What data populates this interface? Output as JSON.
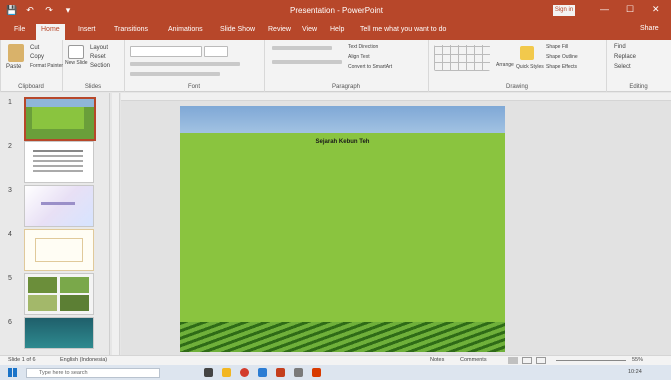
{
  "window": {
    "title": "Presentation - PowerPoint",
    "sign_in": "Sign in",
    "minimize": "—",
    "maximize": "☐",
    "close": "✕"
  },
  "qat": {
    "save": "💾",
    "undo": "↶",
    "redo": "↷",
    "more": "▾"
  },
  "tabs": [
    "File",
    "Home",
    "Insert",
    "Transitions",
    "Animations",
    "Slide Show",
    "Review",
    "View",
    "Help",
    "Tell me what you want to do"
  ],
  "share_label": "Share",
  "ribbon": {
    "clipboard": {
      "paste": "Paste",
      "cut": "Cut",
      "copy": "Copy",
      "format_painter": "Format Painter",
      "label": "Clipboard"
    },
    "slides": {
      "new_slide": "New Slide",
      "layout": "Layout",
      "reset": "Reset",
      "section": "Section",
      "label": "Slides"
    },
    "font": {
      "label": "Font"
    },
    "paragraph": {
      "text_direction": "Text Direction",
      "align_text": "Align Text",
      "convert_smartart": "Convert to SmartArt",
      "label": "Paragraph"
    },
    "drawing": {
      "arrange": "Arrange",
      "quick_styles": "Quick Styles",
      "shape_fill": "Shape Fill",
      "shape_outline": "Shape Outline",
      "shape_effects": "Shape Effects",
      "label": "Drawing"
    },
    "editing": {
      "find": "Find",
      "replace": "Replace",
      "select": "Select",
      "label": "Editing"
    }
  },
  "slide_numbers": [
    "1",
    "2",
    "3",
    "4",
    "5",
    "6"
  ],
  "slide": {
    "title": "Sejarah Kebun Teh",
    "paragraphs": [
      "",
      "",
      ""
    ]
  },
  "status": {
    "slide_info": "Slide 1 of 6",
    "language": "English (Indonesia)",
    "notes": "Notes",
    "comments": "Comments",
    "zoom": "55%"
  },
  "taskbar": {
    "search_placeholder": "Type here to search",
    "time": "10:24"
  },
  "colors": {
    "accent": "#b7472a",
    "slide_text_fill": "#8ac43f"
  }
}
